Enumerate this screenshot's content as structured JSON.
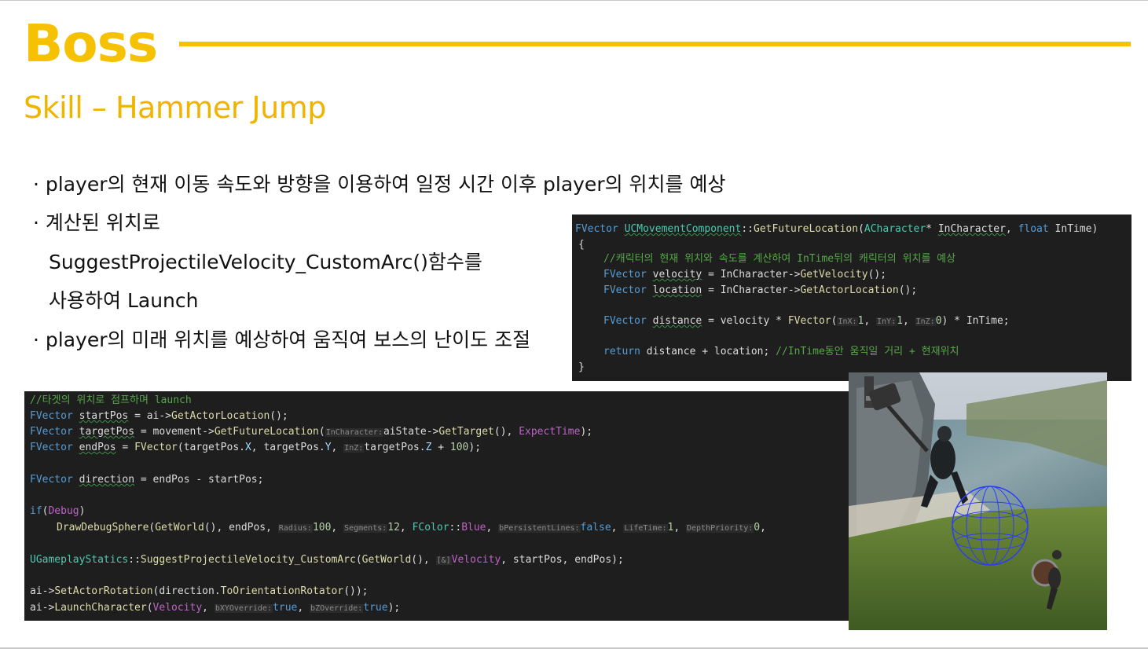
{
  "slide": {
    "title": "Boss",
    "subtitle": "Skill – Hammer Jump",
    "bullets": [
      "· player의 현재 이동 속도와 방향을 이용하여 일정 시간 이후 player의 위치를 예상",
      "· 계산된 위치로",
      "SuggestProjectileVelocity_CustomArc()함수를",
      "사용하여 Launch",
      "· player의 미래 위치를 예상하여 움직여 보스의 난이도 조절"
    ]
  },
  "code1": {
    "l1_a": "FVector",
    "l1_b": "UCMovementComponent",
    "l1_c": "::",
    "l1_d": "GetFutureLocation",
    "l1_e": "(",
    "l1_f": "ACharacter",
    "l1_g": "* ",
    "l1_h": "InCharacter",
    "l1_i": ", ",
    "l1_j": "float",
    "l1_k": " ",
    "l1_l": "InTime",
    "l1_m": ")",
    "l2": "{",
    "l3_cm": "//캐릭터의 현재 위치와 속도를 계산하여 InTime뒤의 캐릭터의 위치를 예상",
    "l4_t": "FVector",
    "l4_v": "velocity",
    "l4_r": " = InCharacter->",
    "l4_f": "GetVelocity",
    "l4_e": "();",
    "l5_t": "FVector",
    "l5_v": "location",
    "l5_r": " = InCharacter->",
    "l5_f": "GetActorLocation",
    "l5_e": "();",
    "l6_t": "FVector",
    "l6_v": "distance",
    "l6_r": " = velocity * ",
    "l6_f": "FVector",
    "l6_p": "(",
    "l6_h1": "InX:",
    "l6_n1": "1",
    "l6_c1": ", ",
    "l6_h2": "InY:",
    "l6_n2": "1",
    "l6_c2": ", ",
    "l6_h3": "InZ:",
    "l6_n3": "0",
    "l6_e": ") * InTime;",
    "l7_k": "return",
    "l7_r": " distance + location; ",
    "l7_cm": "//InTime동안 움직일 거리 + 현재위치",
    "l8": "}"
  },
  "code2": {
    "l1_cm": "//타겟의 위치로 점프하며 launch",
    "l2_t": "FVector",
    "l2_v": "startPos",
    "l2_r": " = ai->",
    "l2_f": "GetActorLocation",
    "l2_e": "();",
    "l3_t": "FVector",
    "l3_v": "targetPos",
    "l3_r": " = movement->",
    "l3_f": "GetFutureLocation",
    "l3_p": "(",
    "l3_h": "InCharacter:",
    "l3_r2": "aiState->",
    "l3_f2": "GetTarget",
    "l3_r3": "(), ",
    "l3_m": "ExpectTime",
    "l3_e": ");",
    "l4_t": "FVector",
    "l4_v": "endPos",
    "l4_r": " = ",
    "l4_f": "FVector",
    "l4_r2": "(targetPos.",
    "l4_x": "X",
    "l4_r3": ", targetPos.",
    "l4_y": "Y",
    "l4_r4": ", ",
    "l4_h": "InZ:",
    "l4_r5": "targetPos.",
    "l4_z": "Z",
    "l4_r6": " + ",
    "l4_n": "100",
    "l4_e": ");",
    "l5_t": "FVector",
    "l5_v": "direction",
    "l5_r": " = endPos - startPos;",
    "l6_k": "if",
    "l6_p": "(",
    "l6_m": "Debug",
    "l6_e": ")",
    "l7_f": "DrawDebugSphere",
    "l7_p": "(",
    "l7_f2": "GetWorld",
    "l7_r": "(), endPos, ",
    "l7_h1": "Radius:",
    "l7_n1": "100",
    "l7_c1": ", ",
    "l7_h2": "Segments:",
    "l7_n2": "12",
    "l7_c2": ", ",
    "l7_t": "FColor",
    "l7_r2": "::",
    "l7_pm": "Blue",
    "l7_c3": ", ",
    "l7_h3": "bPersistentLines:",
    "l7_k1": "false",
    "l7_c4": ", ",
    "l7_h4": "LifeTime:",
    "l7_n4": "1",
    "l7_c5": ", ",
    "l7_h5": "DepthPriority:",
    "l7_n5": "0",
    "l7_e": ",",
    "l8_t": "UGameplayStatics",
    "l8_r": "::",
    "l8_f": "SuggestProjectileVelocity_CustomArc",
    "l8_p": "(",
    "l8_f2": "GetWorld",
    "l8_r2": "(), ",
    "l8_h": "[&]",
    "l8_v": "Velocity",
    "l8_e": ", startPos, endPos);",
    "l9_r": "ai->",
    "l9_f": "SetActorRotation",
    "l9_r2": "(direction.",
    "l9_f2": "ToOrientationRotator",
    "l9_e": "());",
    "l10_r": "ai->",
    "l10_f": "LaunchCharacter",
    "l10_p": "(",
    "l10_v": "Velocity",
    "l10_c1": ", ",
    "l10_h1": "bXYOverride:",
    "l10_k1": "true",
    "l10_c2": ", ",
    "l10_h2": "bZOverride:",
    "l10_k2": "true",
    "l10_e": ");"
  },
  "colors": {
    "accent": "#f5c100",
    "code_bg": "#1e1e1e",
    "keyword": "#569cd6",
    "type": "#4ec9b0",
    "function": "#dcdcaa",
    "comment": "#57a64a",
    "number": "#b5cea8",
    "debug_sphere": "#2a3cff"
  }
}
